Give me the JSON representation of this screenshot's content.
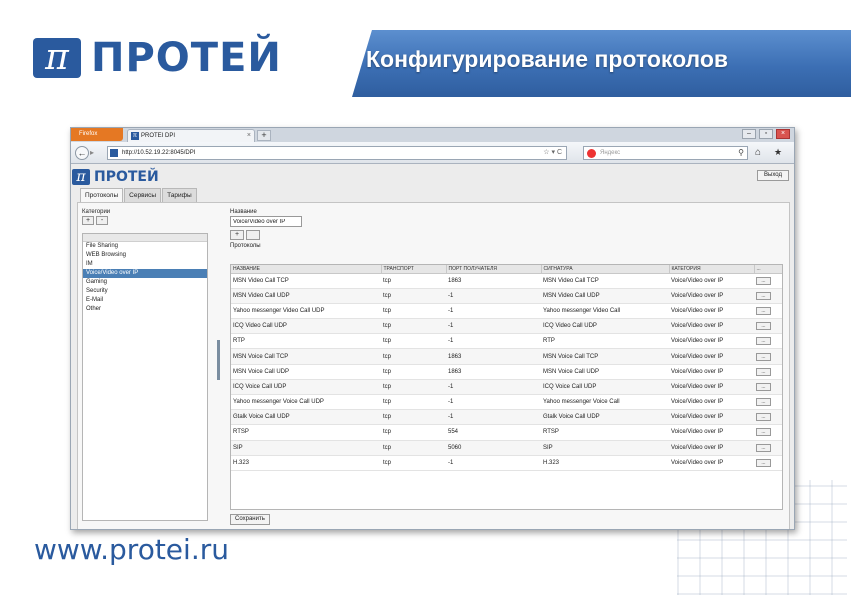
{
  "slide": {
    "logo_text": "ПРОТЕЙ",
    "title": "Конфигурирование протоколов",
    "website": "www.protei.ru"
  },
  "browser": {
    "app_button": "Firefox",
    "tab_title": "PROTEI DPI",
    "tab_close": "×",
    "new_tab": "+",
    "window_buttons": [
      "–",
      "▫",
      "×"
    ],
    "url": "http://10.52.19.22:8045/DPI",
    "search_placeholder": "Яндекс"
  },
  "app": {
    "logo_text": "ПРОТЕЙ",
    "exit_label": "Выход",
    "tabs": [
      "Протоколы",
      "Сервисы",
      "Тарифы"
    ],
    "categories_label": "Категории",
    "add": "+",
    "remove": "-",
    "categories": [
      "File Sharing",
      "WEB Browsing",
      "IM",
      "Voice/Video over IP",
      "Gaming",
      "Security",
      "E-Mail",
      "Other"
    ],
    "selected_category_index": 3,
    "name_label": "Название",
    "name_value": "Voice/Video over IP",
    "protocols_label": "Протоколы",
    "columns": [
      "НАЗВАНИЕ",
      "ТРАНСПОРТ",
      "ПОРТ ПОЛУЧАТЕЛЯ",
      "СИГНАТУРА",
      "КАТЕГОРИЯ",
      "..."
    ],
    "row_button": "...",
    "rows": [
      {
        "name": "MSN Video Call TCP",
        "transport": "tcp",
        "port": "1863",
        "signature": "MSN Video Call TCP",
        "category": "Voice/Video over IP"
      },
      {
        "name": "MSN Video Call UDP",
        "transport": "tcp",
        "port": "-1",
        "signature": "MSN Video Call UDP",
        "category": "Voice/Video over IP"
      },
      {
        "name": "Yahoo messenger Video Call UDP",
        "transport": "tcp",
        "port": "-1",
        "signature": "Yahoo messenger Video Call",
        "category": "Voice/Video over IP"
      },
      {
        "name": "ICQ Video Call UDP",
        "transport": "tcp",
        "port": "-1",
        "signature": "ICQ Video Call UDP",
        "category": "Voice/Video over IP"
      },
      {
        "name": "RTP",
        "transport": "tcp",
        "port": "-1",
        "signature": "RTP",
        "category": "Voice/Video over IP"
      },
      {
        "name": "MSN Voice Call TCP",
        "transport": "tcp",
        "port": "1863",
        "signature": "MSN Voice Call TCP",
        "category": "Voice/Video over IP"
      },
      {
        "name": "MSN Voice Call UDP",
        "transport": "tcp",
        "port": "1863",
        "signature": "MSN Voice Call UDP",
        "category": "Voice/Video over IP"
      },
      {
        "name": "ICQ Voice Call UDP",
        "transport": "tcp",
        "port": "-1",
        "signature": "ICQ Voice Call UDP",
        "category": "Voice/Video over IP"
      },
      {
        "name": "Yahoo messenger Voice Call UDP",
        "transport": "tcp",
        "port": "-1",
        "signature": "Yahoo messenger Voice Call",
        "category": "Voice/Video over IP"
      },
      {
        "name": "Gtalk Voice Call UDP",
        "transport": "tcp",
        "port": "-1",
        "signature": "Gtalk Voice Call UDP",
        "category": "Voice/Video over IP"
      },
      {
        "name": "RTSP",
        "transport": "tcp",
        "port": "554",
        "signature": "RTSP",
        "category": "Voice/Video over IP"
      },
      {
        "name": "SIP",
        "transport": "tcp",
        "port": "5060",
        "signature": "SIP",
        "category": "Voice/Video over IP"
      },
      {
        "name": "H.323",
        "transport": "tcp",
        "port": "-1",
        "signature": "H.323",
        "category": "Voice/Video over IP"
      }
    ],
    "save_label": "Сохранить"
  },
  "colors": {
    "brand": "#2a5a9e",
    "title_band": "#3c6fb4",
    "selection": "#4a7fb5",
    "firefox": "#e57823"
  }
}
